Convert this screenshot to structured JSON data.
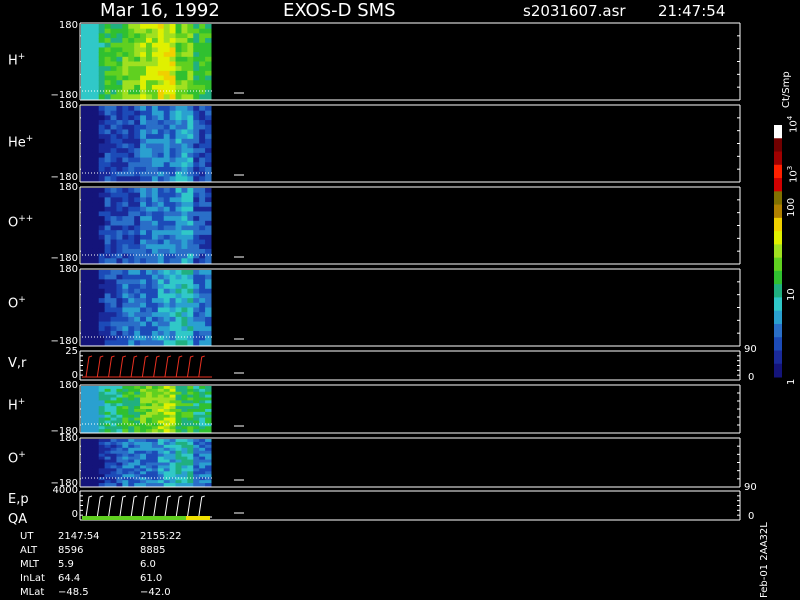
{
  "header": {
    "date": "Mar 16, 1992",
    "instrument": "EXOS-D SMS",
    "file": "s2031607.asr",
    "time": "21:47:54"
  },
  "panels": [
    {
      "label": "H",
      "sup": "+",
      "top_tick": "180",
      "bottom_tick": "−180"
    },
    {
      "label": "He",
      "sup": "+",
      "top_tick": "180",
      "bottom_tick": "−180"
    },
    {
      "label": "O",
      "sup": "++",
      "top_tick": "180",
      "bottom_tick": "−180"
    },
    {
      "label": "O",
      "sup": "+",
      "top_tick": "180",
      "bottom_tick": "−180"
    },
    {
      "label": "V,r",
      "sup": "",
      "top_tick": "25",
      "bottom_tick": "0",
      "right_top": "90",
      "right_bottom": "0"
    },
    {
      "label": "H",
      "sup": "+",
      "top_tick": "180",
      "bottom_tick": "−180"
    },
    {
      "label": "O",
      "sup": "+",
      "top_tick": "180",
      "bottom_tick": "−180"
    },
    {
      "label": "E,p",
      "sup": "",
      "label2": "QA",
      "top_tick": "4000",
      "bottom_tick": "0",
      "right_top": "90",
      "right_bottom": "0"
    }
  ],
  "colorbar": {
    "unit": "Ct/Smp",
    "ticks": [
      {
        "label": "1",
        "frac": 0.0
      },
      {
        "label": "10",
        "frac": 0.333
      },
      {
        "label": "100",
        "frac": 0.667
      },
      {
        "label": "10",
        "sup": "3",
        "frac": 0.8
      },
      {
        "label": "10",
        "sup": "4",
        "frac": 1.0
      }
    ]
  },
  "footer": {
    "rows": [
      {
        "name": "UT",
        "v1": "2147:54",
        "v2": "2155:22"
      },
      {
        "name": "ALT",
        "v1": "8596",
        "v2": "8885"
      },
      {
        "name": "MLT",
        "v1": "5.9",
        "v2": "6.0"
      },
      {
        "name": "InLat",
        "v1": "64.4",
        "v2": "61.0"
      },
      {
        "name": "MLat",
        "v1": "−48.5",
        "v2": "−42.0"
      }
    ],
    "version": "Feb-01 2AA32L"
  },
  "chart_data": {
    "type": "heatmap",
    "title": "Mar 16, 1992   EXOS-D SMS",
    "xlabel": "UT",
    "x_range": [
      "2147:54",
      "2155:22"
    ],
    "ylim": [
      -180,
      180
    ],
    "colorscale": "log",
    "color_range": [
      1,
      10000
    ],
    "panel_levels": {
      "H+": "high (10-100+ Ct/Smp, green/yellow)",
      "He+": "low (1-10 Ct/Smp, blue/cyan)",
      "O++": "low (1-10 Ct/Smp, blue)",
      "O+": "low-moderate (1-10 Ct/Smp, blue/cyan)",
      "H+ (2)": "moderate (10-100 Ct/Smp, green)",
      "O+ (2)": "low-moderate (1-10 Ct/Smp, blue/cyan)"
    }
  }
}
